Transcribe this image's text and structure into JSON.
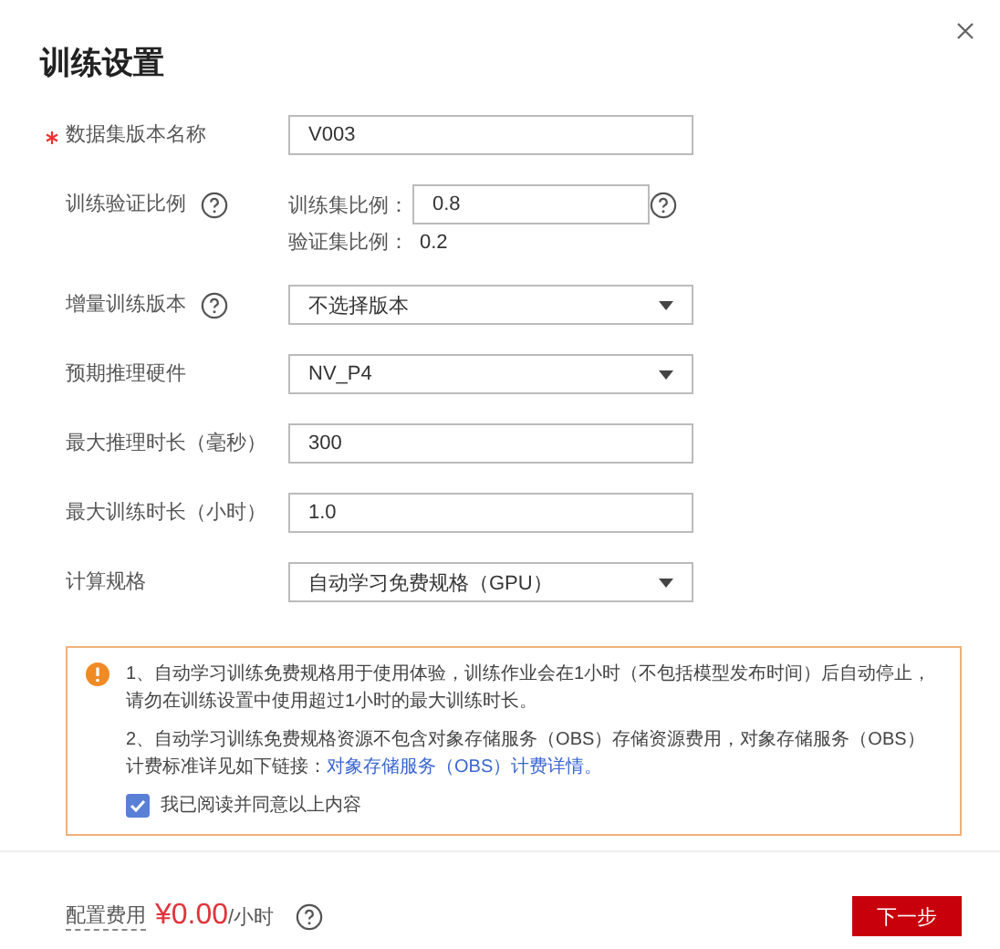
{
  "title": "训练设置",
  "fields": [
    {
      "kind": "input",
      "label": "数据集版本名称",
      "required": true,
      "help": false,
      "value": "V003"
    },
    {
      "kind": "ratio",
      "label": "训练验证比例",
      "required": false,
      "help": true,
      "train_label": "训练集比例：",
      "train_value": "0.8",
      "val_label": "验证集比例：",
      "val_value": "0.2"
    },
    {
      "kind": "select",
      "label": "增量训练版本",
      "required": false,
      "help": true,
      "value": "不选择版本"
    },
    {
      "kind": "select",
      "label": "预期推理硬件",
      "required": false,
      "help": false,
      "value": "NV_P4"
    },
    {
      "kind": "input",
      "label": "最大推理时长（毫秒）",
      "required": false,
      "help": false,
      "value": "300"
    },
    {
      "kind": "input",
      "label": "最大训练时长（小时）",
      "required": false,
      "help": false,
      "value": "1.0"
    },
    {
      "kind": "select",
      "label": "计算规格",
      "required": false,
      "help": false,
      "value": "自动学习免费规格（GPU）"
    }
  ],
  "notice": {
    "items": [
      {
        "text": "1、自动学习训练免费规格用于使用体验，训练作业会在1小时（不包括模型发布时间）后自动停止，请勿在训练设置中使用超过1小时的最大训练时长。"
      },
      {
        "text": "2、自动学习训练免费规格资源不包含对象存储服务（OBS）存储资源费用，对象存储服务（OBS）计费标准详见如下链接：",
        "link": "对象存储服务（OBS）计费详情。"
      }
    ],
    "agree": {
      "label": "我已阅读并同意以上内容",
      "checked": true
    }
  },
  "footer": {
    "cost_label": "配置费用",
    "price": "¥0.00",
    "unit": "/小时",
    "next": "下一步"
  }
}
